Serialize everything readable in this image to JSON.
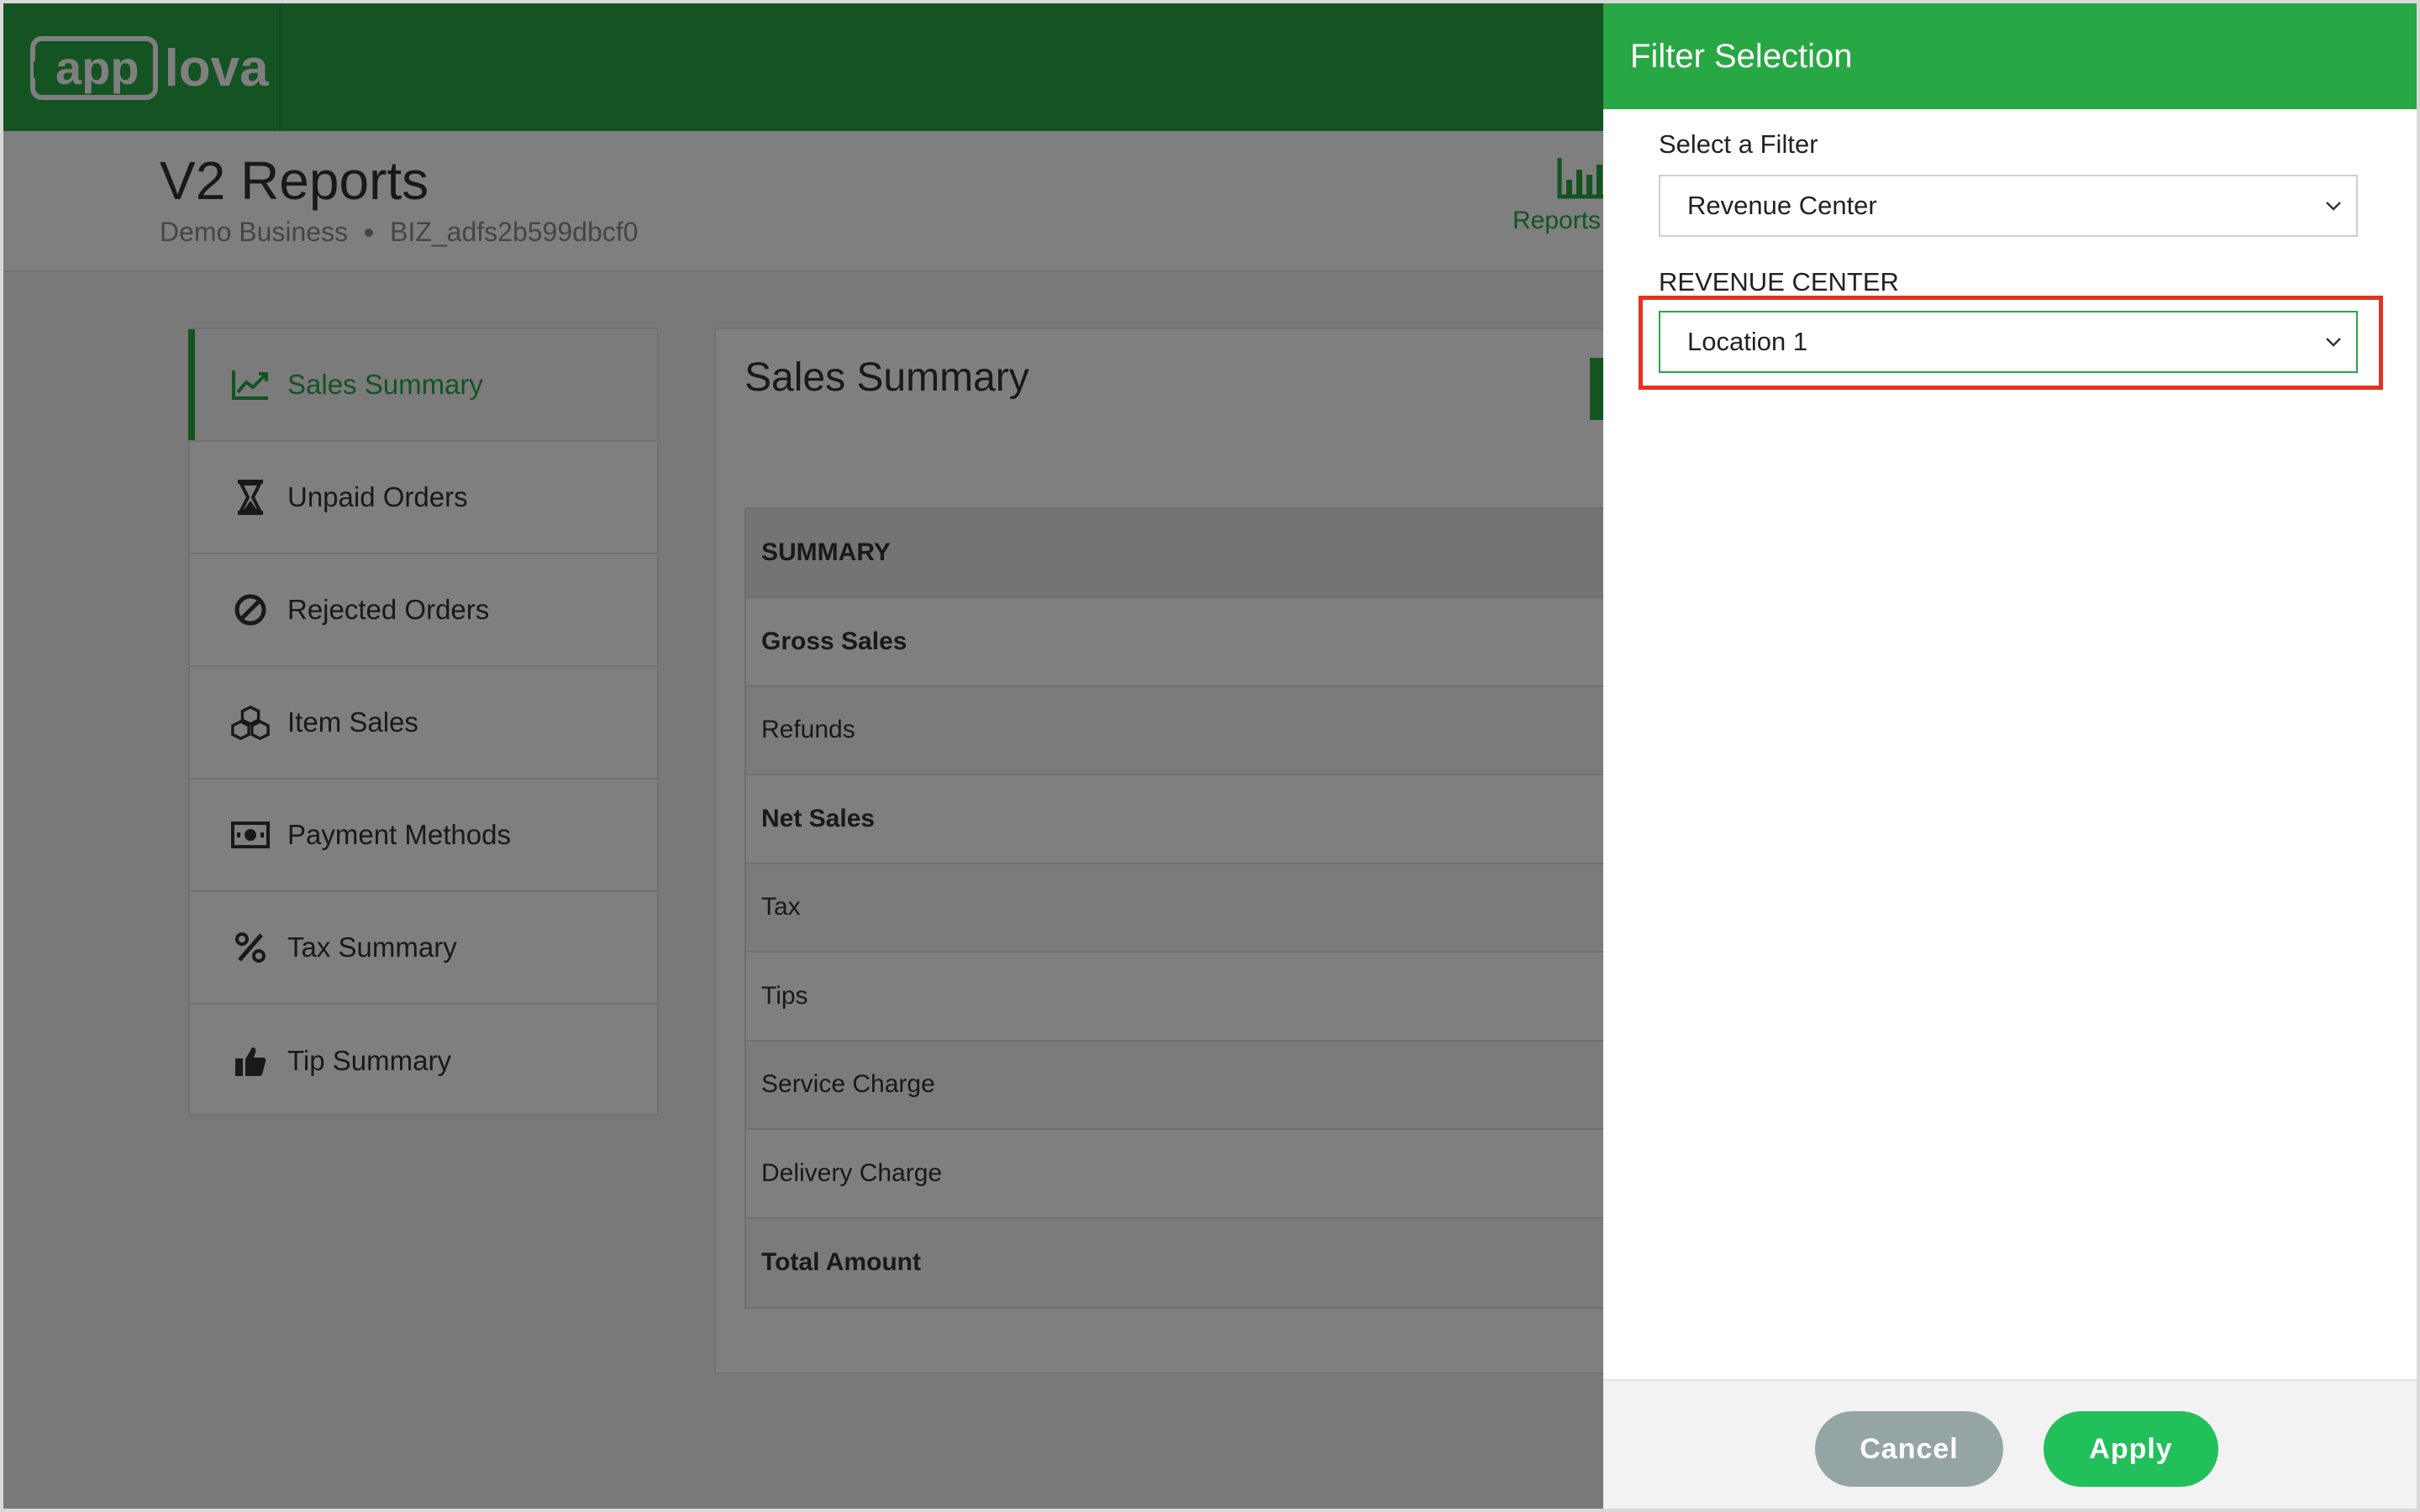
{
  "app": {
    "logo_app": "app",
    "logo_lova": "lova"
  },
  "header": {
    "title": "V2 Reports",
    "business": "Demo Business",
    "business_id": "BIZ_adfs2b599dbcf0",
    "reports_label": "Reports"
  },
  "sidebar": {
    "items": [
      {
        "label": "Sales Summary",
        "icon": "line-chart-icon"
      },
      {
        "label": "Unpaid Orders",
        "icon": "hourglass-icon"
      },
      {
        "label": "Rejected Orders",
        "icon": "ban-icon"
      },
      {
        "label": "Item Sales",
        "icon": "cubes-icon"
      },
      {
        "label": "Payment Methods",
        "icon": "money-icon"
      },
      {
        "label": "Tax Summary",
        "icon": "percent-icon"
      },
      {
        "label": "Tip Summary",
        "icon": "thumbs-up-icon"
      }
    ]
  },
  "main": {
    "title": "Sales Summary",
    "table_header": "SUMMARY",
    "rows": [
      "Gross Sales",
      "Refunds",
      "Net Sales",
      "Tax",
      "Tips",
      "Service Charge",
      "Delivery Charge",
      "Total Amount"
    ]
  },
  "drawer": {
    "title": "Filter Selection",
    "filter_label": "Select a Filter",
    "filter_value": "Revenue Center",
    "rc_label": "REVENUE CENTER",
    "rc_value": "Location 1",
    "cancel": "Cancel",
    "apply": "Apply"
  },
  "colors": {
    "brand_green": "#28a745",
    "apply_green": "#22c05a",
    "cancel_gray": "#95a5a6",
    "highlight_red": "#e53222"
  }
}
